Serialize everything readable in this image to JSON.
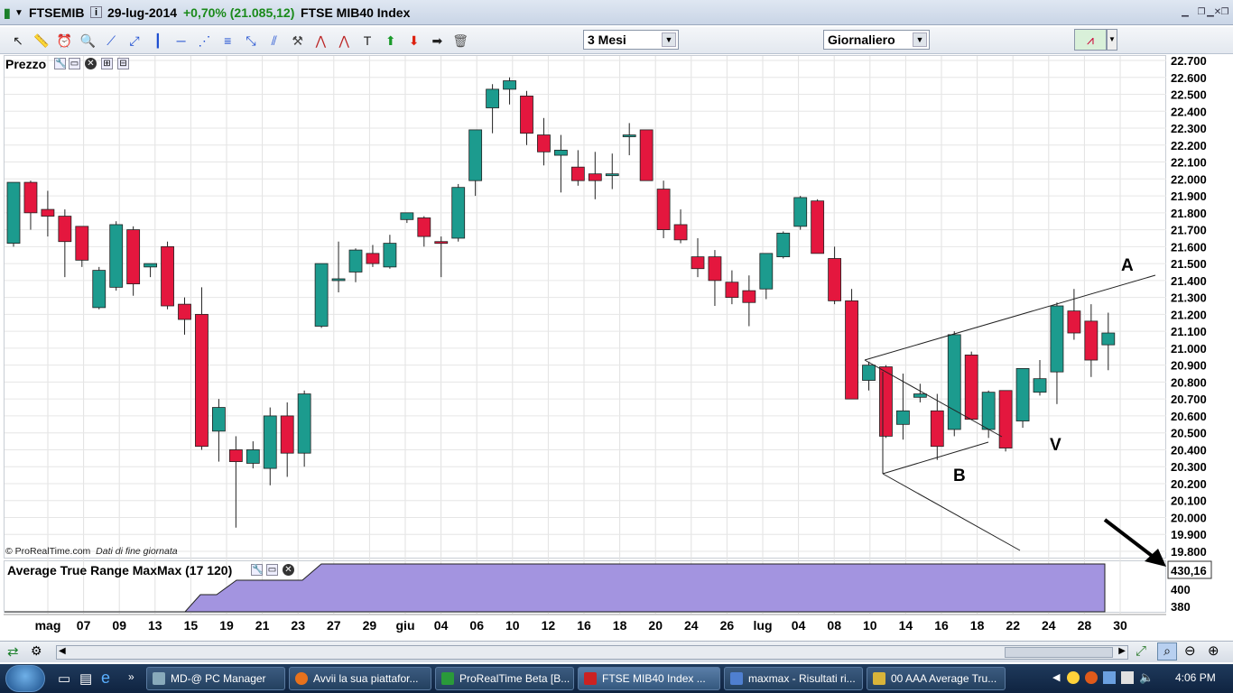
{
  "window": {
    "symbol": "FTSEMIB",
    "date": "29-lug-2014",
    "change": "+0,70% (21.085,12)",
    "instrument": "FTSE MIB40 Index"
  },
  "toolbar": {
    "period_select": "3 Mesi",
    "interval_select": "Giornaliero",
    "icons": [
      "pointer-icon",
      "ruler-icon",
      "alarm-icon",
      "zoom-icon",
      "line-icon",
      "ray-icon",
      "vertical-line-icon",
      "horizontal-line-icon",
      "channel-icon",
      "fibonacci-icon",
      "arrows-icon",
      "parallel-icon",
      "tools-icon",
      "zigzag-icon",
      "pattern-icon",
      "text-icon",
      "up-arrow-icon",
      "down-arrow-icon",
      "right-arrow-icon",
      "trash-icon"
    ]
  },
  "price_panel": {
    "label": "Prezzo",
    "credit_source": "© ProRealTime.com",
    "credit_note": "Dati di fine giornata",
    "annotations": [
      "A",
      "B",
      "V"
    ]
  },
  "atr_panel": {
    "label": "Average True Range MaxMax (17 120)",
    "value_badge": "430,16",
    "ticks": [
      "400",
      "380"
    ]
  },
  "y_axis": {
    "ticks": [
      "22.700",
      "22.600",
      "22.500",
      "22.400",
      "22.300",
      "22.200",
      "22.100",
      "22.000",
      "21.900",
      "21.800",
      "21.700",
      "21.600",
      "21.500",
      "21.400",
      "21.300",
      "21.200",
      "21.100",
      "21.000",
      "20.900",
      "20.800",
      "20.700",
      "20.600",
      "20.500",
      "20.400",
      "20.300",
      "20.200",
      "20.100",
      "20.000",
      "19.900",
      "19.800"
    ]
  },
  "x_axis": {
    "labels": [
      "mag",
      "07",
      "09",
      "13",
      "15",
      "19",
      "21",
      "23",
      "27",
      "29",
      "giu",
      "04",
      "06",
      "10",
      "12",
      "16",
      "18",
      "20",
      "24",
      "26",
      "lug",
      "04",
      "08",
      "10",
      "14",
      "16",
      "18",
      "22",
      "24",
      "28",
      "30"
    ]
  },
  "colors": {
    "up": "#1c9b8e",
    "down": "#e4173e",
    "atr_fill": "#a394e0"
  },
  "chart_data": {
    "type": "candlestick",
    "title": "FTSE MIB40 Index",
    "ylim": [
      19750,
      22750
    ],
    "candles": [
      {
        "o": 21620,
        "h": 21980,
        "l": 21600,
        "c": 21980
      },
      {
        "o": 21980,
        "h": 21990,
        "l": 21700,
        "c": 21800
      },
      {
        "o": 21820,
        "h": 21930,
        "l": 21660,
        "c": 21780
      },
      {
        "o": 21780,
        "h": 21820,
        "l": 21420,
        "c": 21630
      },
      {
        "o": 21720,
        "h": 21720,
        "l": 21480,
        "c": 21520
      },
      {
        "o": 21240,
        "h": 21480,
        "l": 21230,
        "c": 21460
      },
      {
        "o": 21360,
        "h": 21750,
        "l": 21340,
        "c": 21730
      },
      {
        "o": 21700,
        "h": 21720,
        "l": 21310,
        "c": 21380
      },
      {
        "o": 21480,
        "h": 21500,
        "l": 21420,
        "c": 21500
      },
      {
        "o": 21600,
        "h": 21630,
        "l": 21230,
        "c": 21250
      },
      {
        "o": 21260,
        "h": 21300,
        "l": 21080,
        "c": 21170
      },
      {
        "o": 21200,
        "h": 21360,
        "l": 20400,
        "c": 20420
      },
      {
        "o": 20510,
        "h": 20700,
        "l": 20330,
        "c": 20650
      },
      {
        "o": 20400,
        "h": 20480,
        "l": 19940,
        "c": 20330
      },
      {
        "o": 20320,
        "h": 20450,
        "l": 20290,
        "c": 20400
      },
      {
        "o": 20290,
        "h": 20650,
        "l": 20190,
        "c": 20600
      },
      {
        "o": 20600,
        "h": 20680,
        "l": 20240,
        "c": 20380
      },
      {
        "o": 20380,
        "h": 20750,
        "l": 20300,
        "c": 20730
      },
      {
        "o": 21130,
        "h": 21500,
        "l": 21120,
        "c": 21500
      },
      {
        "o": 21410,
        "h": 21630,
        "l": 21330,
        "c": 21410
      },
      {
        "o": 21450,
        "h": 21590,
        "l": 21390,
        "c": 21580
      },
      {
        "o": 21560,
        "h": 21610,
        "l": 21480,
        "c": 21500
      },
      {
        "o": 21480,
        "h": 21670,
        "l": 21470,
        "c": 21620
      },
      {
        "o": 21760,
        "h": 21800,
        "l": 21740,
        "c": 21800
      },
      {
        "o": 21770,
        "h": 21780,
        "l": 21600,
        "c": 21660
      },
      {
        "o": 21630,
        "h": 21660,
        "l": 21420,
        "c": 21620
      },
      {
        "o": 21650,
        "h": 21970,
        "l": 21630,
        "c": 21950
      },
      {
        "o": 21990,
        "h": 22290,
        "l": 21900,
        "c": 22290
      },
      {
        "o": 22420,
        "h": 22560,
        "l": 22270,
        "c": 22530
      },
      {
        "o": 22530,
        "h": 22600,
        "l": 22440,
        "c": 22580
      },
      {
        "o": 22490,
        "h": 22520,
        "l": 22200,
        "c": 22270
      },
      {
        "o": 22260,
        "h": 22360,
        "l": 22080,
        "c": 22160
      },
      {
        "o": 22140,
        "h": 22260,
        "l": 21920,
        "c": 22170
      },
      {
        "o": 22070,
        "h": 22170,
        "l": 21960,
        "c": 21990
      },
      {
        "o": 22030,
        "h": 22160,
        "l": 21880,
        "c": 21990
      },
      {
        "o": 22030,
        "h": 22150,
        "l": 21940,
        "c": 22030
      },
      {
        "o": 22260,
        "h": 22330,
        "l": 22140,
        "c": 22260
      },
      {
        "o": 22290,
        "h": 22290,
        "l": 21990,
        "c": 21990
      },
      {
        "o": 21940,
        "h": 21990,
        "l": 21650,
        "c": 21700
      },
      {
        "o": 21730,
        "h": 21820,
        "l": 21620,
        "c": 21640
      },
      {
        "o": 21540,
        "h": 21650,
        "l": 21420,
        "c": 21470
      },
      {
        "o": 21540,
        "h": 21580,
        "l": 21250,
        "c": 21400
      },
      {
        "o": 21390,
        "h": 21460,
        "l": 21260,
        "c": 21300
      },
      {
        "o": 21340,
        "h": 21430,
        "l": 21130,
        "c": 21270
      },
      {
        "o": 21350,
        "h": 21560,
        "l": 21290,
        "c": 21560
      },
      {
        "o": 21540,
        "h": 21690,
        "l": 21530,
        "c": 21680
      },
      {
        "o": 21720,
        "h": 21900,
        "l": 21700,
        "c": 21890
      },
      {
        "o": 21870,
        "h": 21880,
        "l": 21560,
        "c": 21560
      },
      {
        "o": 21530,
        "h": 21600,
        "l": 21260,
        "c": 21280
      },
      {
        "o": 21280,
        "h": 21350,
        "l": 20700,
        "c": 20700
      },
      {
        "o": 20810,
        "h": 20920,
        "l": 20750,
        "c": 20900
      },
      {
        "o": 20890,
        "h": 20900,
        "l": 20470,
        "c": 20480
      },
      {
        "o": 20550,
        "h": 20850,
        "l": 20460,
        "c": 20630
      },
      {
        "o": 20710,
        "h": 20790,
        "l": 20680,
        "c": 20730
      },
      {
        "o": 20630,
        "h": 20730,
        "l": 20340,
        "c": 20420
      },
      {
        "o": 20520,
        "h": 21100,
        "l": 20480,
        "c": 21080
      },
      {
        "o": 20960,
        "h": 20980,
        "l": 20580,
        "c": 20580
      },
      {
        "o": 20520,
        "h": 20750,
        "l": 20470,
        "c": 20740
      },
      {
        "o": 20750,
        "h": 20750,
        "l": 20390,
        "c": 20410
      },
      {
        "o": 20570,
        "h": 20880,
        "l": 20530,
        "c": 20880
      },
      {
        "o": 20740,
        "h": 20930,
        "l": 20720,
        "c": 20820
      },
      {
        "o": 20860,
        "h": 21270,
        "l": 20670,
        "c": 21250
      },
      {
        "o": 21220,
        "h": 21350,
        "l": 21050,
        "c": 21090
      },
      {
        "o": 21160,
        "h": 21260,
        "l": 20830,
        "c": 20930
      },
      {
        "o": 21020,
        "h": 21210,
        "l": 20870,
        "c": 21090
      }
    ],
    "atr_line": {
      "last_value": 430.16,
      "ylim": [
        370,
        440
      ]
    }
  }
}
